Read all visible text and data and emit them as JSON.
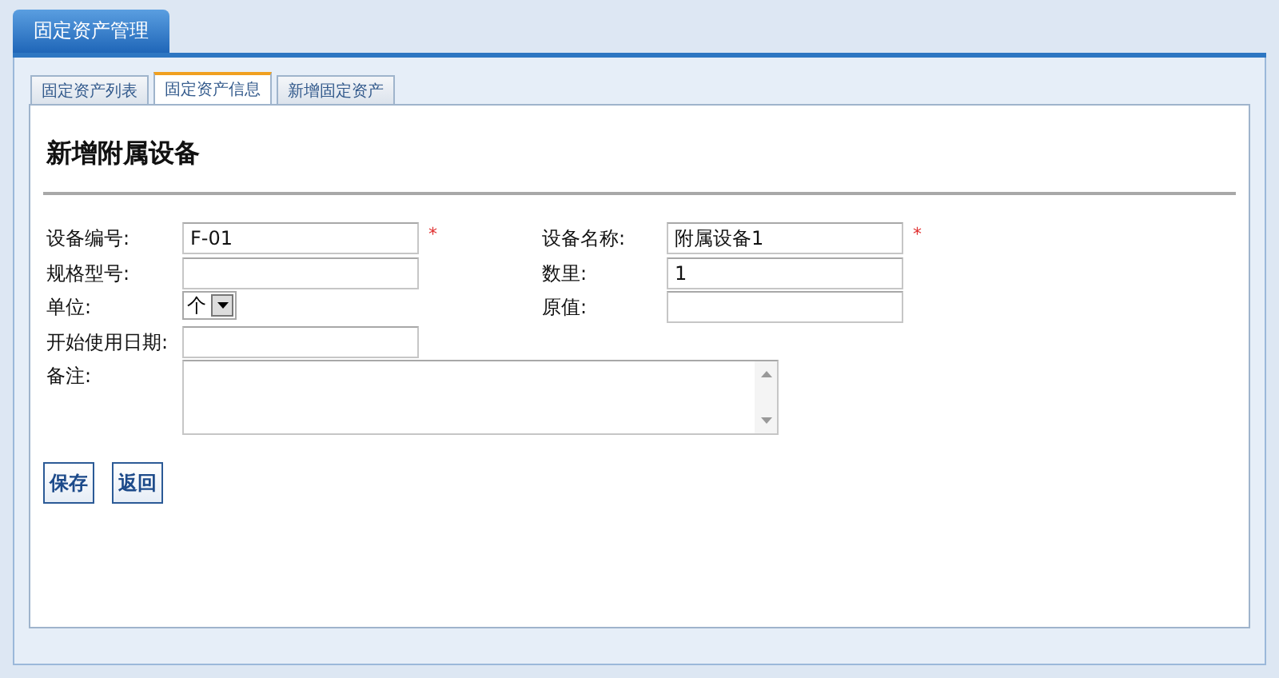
{
  "app_tab": {
    "label": "固定资产管理"
  },
  "tabs": [
    {
      "label": "固定资产列表",
      "selected": false
    },
    {
      "label": "固定资产信息",
      "selected": true
    },
    {
      "label": "新增固定资产",
      "selected": false
    }
  ],
  "title": "新增附属设备",
  "rows": [
    [
      {
        "label": "设备编号:",
        "kind": "text",
        "value": "F-01",
        "mark": "*"
      },
      {
        "label": "设备名称:",
        "kind": "text",
        "value": "附属设备1",
        "mark": "*"
      }
    ],
    [
      {
        "label": "规格型号:",
        "kind": "text"
      },
      {
        "label": "数里:",
        "kind": "text",
        "value": "1"
      }
    ],
    [
      {
        "label": "单位:",
        "kind": "select",
        "value": "个"
      },
      {
        "label": "原值:",
        "kind": "text"
      }
    ],
    [
      {
        "label": "开始使用日期:",
        "kind": "text"
      }
    ],
    [
      {
        "label": "备注:",
        "kind": "textarea"
      }
    ]
  ],
  "buttons": [
    "保存",
    "返回"
  ]
}
